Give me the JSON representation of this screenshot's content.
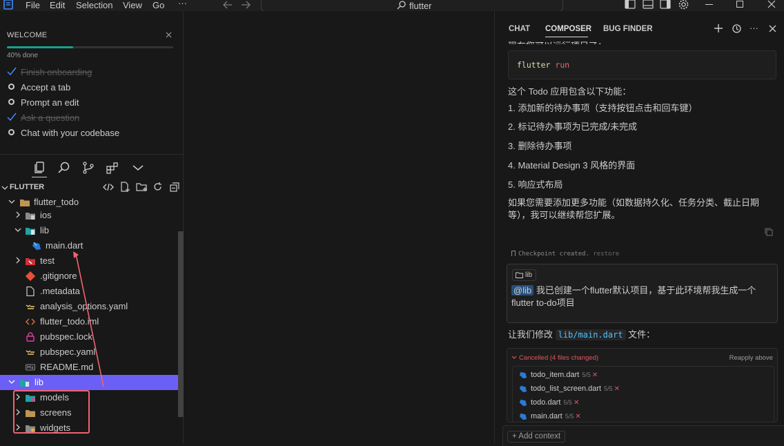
{
  "titlebar": {
    "menu": [
      "File",
      "Edit",
      "Selection",
      "View",
      "Go"
    ],
    "more": "···",
    "search_text": "flutter"
  },
  "welcome": {
    "title": "WELCOME",
    "progress_label": "40% done",
    "progress_fraction": 0.4,
    "tasks": [
      {
        "label": "Finish onboarding",
        "done": true
      },
      {
        "label": "Accept a tab",
        "done": false
      },
      {
        "label": "Prompt an edit",
        "done": false
      },
      {
        "label": "Ask a question",
        "done": true
      },
      {
        "label": "Chat with your codebase",
        "done": false
      }
    ]
  },
  "explorer": {
    "header": "FLUTTER",
    "rows": [
      {
        "label": "flutter_todo"
      },
      {
        "label": "ios"
      },
      {
        "label": "lib"
      },
      {
        "label": "main.dart"
      },
      {
        "label": "test"
      },
      {
        "label": ".gitignore"
      },
      {
        "label": ".metadata"
      },
      {
        "label": "analysis_options.yaml"
      },
      {
        "label": "flutter_todo.iml"
      },
      {
        "label": "pubspec.lock"
      },
      {
        "label": "pubspec.yaml"
      },
      {
        "label": "README.md"
      },
      {
        "label": "lib"
      },
      {
        "label": "models"
      },
      {
        "label": "screens"
      },
      {
        "label": "widgets"
      }
    ]
  },
  "panel": {
    "tabs": [
      "CHAT",
      "COMPOSER",
      "BUG FINDER"
    ],
    "active_tab": "COMPOSER",
    "cut_line": "现在您可以运行项目了：",
    "code_cmd": "flutter",
    "code_arg": "run",
    "intro": "这个 Todo 应用包含以下功能：",
    "features": [
      "1. 添加新的待办事项（支持按钮点击和回车键）",
      "2. 标记待办事项为已完成/未完成",
      "3. 删除待办事项",
      "4. Material Design 3 风格的界面",
      "5. 响应式布局"
    ],
    "followup_line1": "如果您需要添加更多功能（如数据持久化、任务分类、截止日期",
    "followup_line2": "等），我可以继续帮您扩展。",
    "checkpoint_text": "Checkpoint created.",
    "checkpoint_restore": "restore",
    "user_chip": "lib",
    "user_mention": "@lib",
    "user_text_rest": " 我已创建一个flutter默认项目，基于此环境帮我生成一个flutter to-do项目",
    "modify_prefix": "让我们修改 ",
    "modify_file": "lib/main.dart",
    "modify_suffix": " 文件：",
    "changes_status": "Cancelled",
    "changes_count": "(4 files changed)",
    "reapply": "Reapply above",
    "files": [
      {
        "name": "todo_item.dart",
        "count": "5/5"
      },
      {
        "name": "todo_list_screen.dart",
        "count": "5/5"
      },
      {
        "name": "todo.dart",
        "count": "5/5"
      },
      {
        "name": "main.dart",
        "count": "5/5"
      }
    ],
    "add_context": "+ Add context"
  },
  "colors": {
    "accent_selected": "#6b5ff5",
    "progress": "#15a48b",
    "annotation": "#f06470",
    "cancelled": "#e05561"
  }
}
